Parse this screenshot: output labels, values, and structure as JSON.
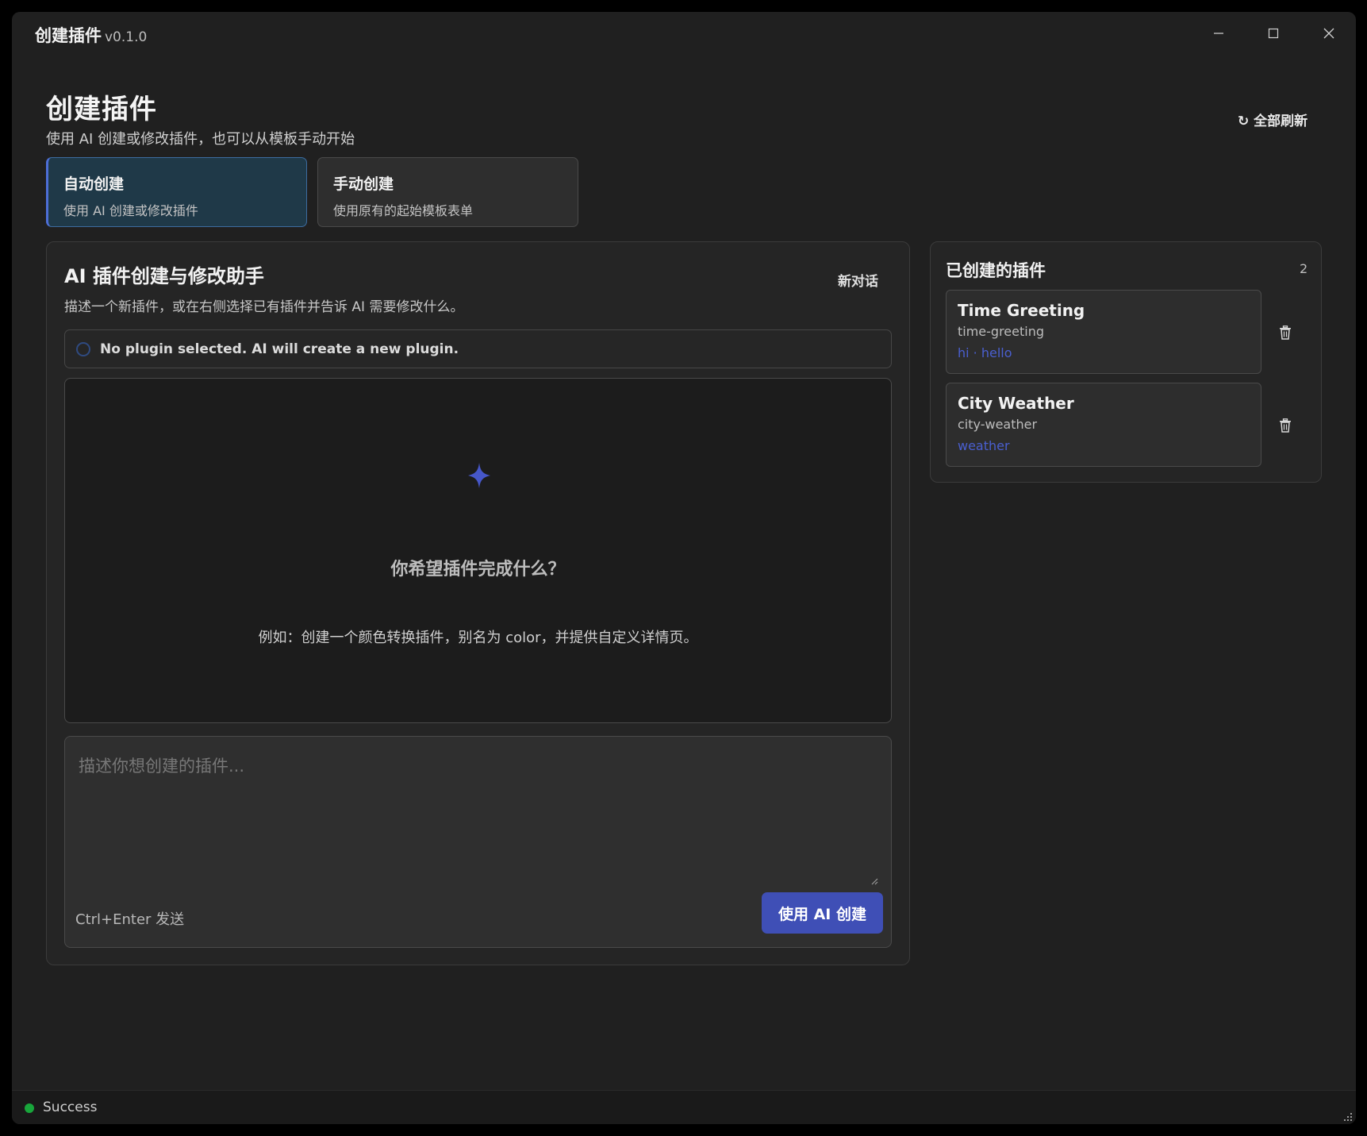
{
  "window": {
    "title": "创建插件",
    "version": "v0.1.0"
  },
  "header": {
    "title": "创建插件",
    "subtitle": "使用 AI 创建或修改插件，也可以从模板手动开始",
    "refresh_label": "↻ 全部刷新"
  },
  "modes": [
    {
      "title": "自动创建",
      "desc": "使用 AI 创建或修改插件",
      "active": true
    },
    {
      "title": "手动创建",
      "desc": "使用原有的起始模板表单",
      "active": false
    }
  ],
  "assistant": {
    "title": "AI 插件创建与修改助手",
    "desc": "描述一个新插件，或在右侧选择已有插件并告诉 AI 需要修改什么。",
    "new_chat_label": "新对话",
    "selection_status": "No plugin selected. AI will create a new plugin.",
    "empty_title": "你希望插件完成什么？",
    "empty_example": "例如：创建一个颜色转换插件，别名为 color，并提供自定义详情页。",
    "input_placeholder": "描述你想创建的插件...",
    "input_value": "",
    "hint": "Ctrl+Enter 发送",
    "submit_label": "使用 AI 创建"
  },
  "plugins": {
    "title": "已创建的插件",
    "count": "2",
    "items": [
      {
        "name": "Time Greeting",
        "id": "time-greeting",
        "aliases": "hi · hello"
      },
      {
        "name": "City Weather",
        "id": "city-weather",
        "aliases": "weather"
      }
    ]
  },
  "status": {
    "text": "Success"
  },
  "colors": {
    "accent": "#3f4fb6",
    "alias_link": "#4a5fd0",
    "success": "#18a63b",
    "active_card_bg": "#1f3948"
  },
  "icons": [
    "minimize-icon",
    "maximize-icon",
    "close-icon",
    "refresh-icon",
    "sparkle-icon",
    "trash-icon",
    "resize-grip-icon"
  ]
}
